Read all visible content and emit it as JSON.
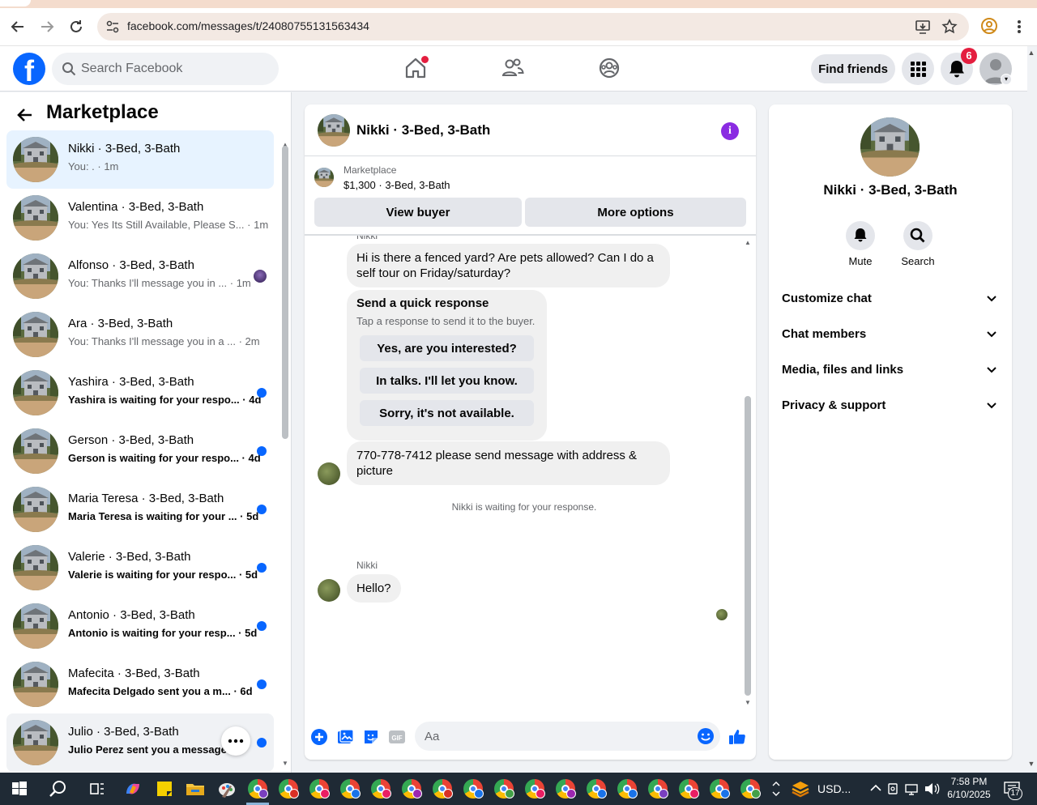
{
  "browser": {
    "url": "facebook.com/messages/t/24080755131563434",
    "back_icon": "arrow-left-icon",
    "forward_icon": "arrow-right-icon",
    "reload_icon": "reload-icon"
  },
  "fb_nav": {
    "search_placeholder": "Search Facebook",
    "find_friends_label": "Find friends",
    "notification_count": "6",
    "brand_color": "#0866ff",
    "badge_color": "#e41e3f"
  },
  "sidebar": {
    "title": "Marketplace",
    "conversations": [
      {
        "name": "Nikki · 3-Bed, 3-Bath",
        "preview": "You: . · 1m",
        "state": "active"
      },
      {
        "name": "Valentina · 3-Bed, 3-Bath",
        "preview": "You: Yes Its Still Available, Please S... · 1m",
        "state": "read"
      },
      {
        "name": "Alfonso · 3-Bed, 3-Bath",
        "preview": "You: Thanks I'll message you in ... · 1m",
        "state": "read"
      },
      {
        "name": "Ara · 3-Bed, 3-Bath",
        "preview": "You: Thanks I'll message you in a ... · 2m",
        "state": "read"
      },
      {
        "name": "Yashira · 3-Bed, 3-Bath",
        "preview": "Yashira is waiting for your respo... · 4d",
        "state": "unread"
      },
      {
        "name": "Gerson · 3-Bed, 3-Bath",
        "preview": "Gerson is waiting for your respo... · 4d",
        "state": "unread"
      },
      {
        "name": "Maria Teresa · 3-Bed, 3-Bath",
        "preview": "Maria Teresa is waiting for your ... · 5d",
        "state": "unread"
      },
      {
        "name": "Valerie · 3-Bed, 3-Bath",
        "preview": "Valerie is waiting for your respo... · 5d",
        "state": "unread"
      },
      {
        "name": "Antonio · 3-Bed, 3-Bath",
        "preview": "Antonio is waiting for your resp... · 5d",
        "state": "unread"
      },
      {
        "name": "Mafecita · 3-Bed, 3-Bath",
        "preview": "Mafecita Delgado sent you a m... · 6d",
        "state": "unread"
      },
      {
        "name": "Julio · 3-Bed, 3-Bath",
        "preview": "Julio Perez sent you a message ...",
        "state": "unread"
      }
    ]
  },
  "chat": {
    "title": "Nikki · 3-Bed, 3-Bath",
    "listing_category": "Marketplace",
    "listing_price": "$1,300 · 3-Bed, 3-Bath",
    "view_buyer_label": "View buyer",
    "more_options_label": "More options",
    "sender_name": "Nikki",
    "messages": {
      "first": "Hi is there a fenced yard? Are pets allowed? Can I do a self tour on Friday/saturday?",
      "phone": "770-778-7412 please send message with address & picture",
      "hello": "Hello?"
    },
    "quick_response": {
      "title": "Send a quick response",
      "subtitle": "Tap a response to send it to the buyer.",
      "options": [
        "Yes, are you interested?",
        "In talks. I'll let you know.",
        "Sorry, it's not available."
      ]
    },
    "waiting_note": "Nikki is waiting for your response.",
    "composer_placeholder": "Aa",
    "accent_color": "#0866ff"
  },
  "right_panel": {
    "name": "Nikki · 3-Bed, 3-Bath",
    "mute_label": "Mute",
    "search_label": "Search",
    "sections": [
      "Customize chat",
      "Chat members",
      "Media, files and links",
      "Privacy & support"
    ]
  },
  "taskbar": {
    "tray_label": "USD...",
    "time": "7:58 PM",
    "date": "6/10/2025",
    "notification_count": "17"
  }
}
